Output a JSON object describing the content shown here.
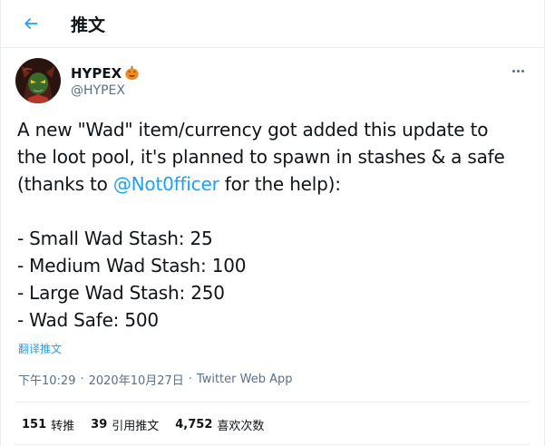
{
  "header": {
    "title": "推文",
    "back_icon": "arrow-left-icon"
  },
  "author": {
    "display_name": "HYPEX",
    "emoji": "jack-o-lantern-icon",
    "handle": "@HYPEX"
  },
  "tweet": {
    "lines": [
      "A new \"Wad\" item/currency got added this update to",
      "the loot pool, it's planned to spawn in stashes & a safe",
      "(thanks to ",
      "",
      "- Small Wad Stash: 25",
      "- Medium Wad Stash: 100",
      "- Large Wad Stash: 250",
      "- Wad Safe: 500"
    ],
    "mention": "@Not0fficer",
    "after_mention": " for the help):"
  },
  "translate_label": "翻译推文",
  "meta": {
    "time": "下午10:29",
    "date": "2020年10月27日",
    "app": "Twitter Web App",
    "separator": "·"
  },
  "stats": [
    {
      "count": "151",
      "label": "转推"
    },
    {
      "count": "39",
      "label": "引用推文"
    },
    {
      "count": "4,752",
      "label": "喜欢次数"
    }
  ],
  "colors": {
    "accent": "#1da1f2",
    "text": "#0f1419",
    "secondary": "#5b7083",
    "border": "#ebeef0"
  }
}
